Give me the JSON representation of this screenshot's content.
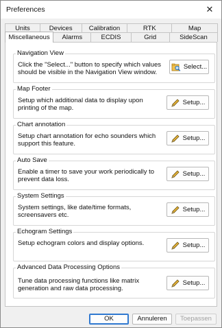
{
  "window": {
    "title": "Preferences",
    "close_glyph": "✕"
  },
  "tabs": {
    "back_row": [
      "Units",
      "Devices",
      "Calibration",
      "RTK",
      "Map"
    ],
    "front_row": [
      "Miscellaneous",
      "Alarms",
      "ECDIS",
      "Grid",
      "SideScan"
    ],
    "selected": "Miscellaneous"
  },
  "groups": [
    {
      "title": "Navigation View",
      "description": "Click the \"Select...\" button to specify which values should be visible in the Navigation View window.",
      "button_label": "Select...",
      "button_icon": "select-search-icon"
    },
    {
      "title": "Map Footer",
      "description": "Setup which additional data to display upon printing of the map.",
      "button_label": "Setup...",
      "button_icon": "pencil-icon"
    },
    {
      "title": "Chart annotation",
      "description": "Setup chart annotation for echo sounders which support this feature.",
      "button_label": "Setup...",
      "button_icon": "pencil-icon"
    },
    {
      "title": "Auto Save",
      "description": "Enable a timer to save your work periodically to prevent data loss.",
      "button_label": "Setup...",
      "button_icon": "pencil-icon"
    },
    {
      "title": "System Settings",
      "description": "System settings, like date/time formats, screensavers etc.",
      "button_label": "Setup...",
      "button_icon": "pencil-icon"
    },
    {
      "title": "Echogram Settings",
      "description": "Setup echogram colors and display options.",
      "button_label": "Setup...",
      "button_icon": "pencil-icon"
    },
    {
      "title": "Advanced Data Processing Options",
      "description": "Tune data processing functions like matrix generation and raw data processing.",
      "button_label": "Setup...",
      "button_icon": "pencil-icon"
    }
  ],
  "footer": {
    "ok_label": "OK",
    "cancel_label": "Annuleren",
    "apply_label": "Toepassen"
  },
  "colors": {
    "default_button_border": "#2f78d0",
    "pencil_yellow": "#e8b53a",
    "disabled_text": "#a0a0a0"
  }
}
